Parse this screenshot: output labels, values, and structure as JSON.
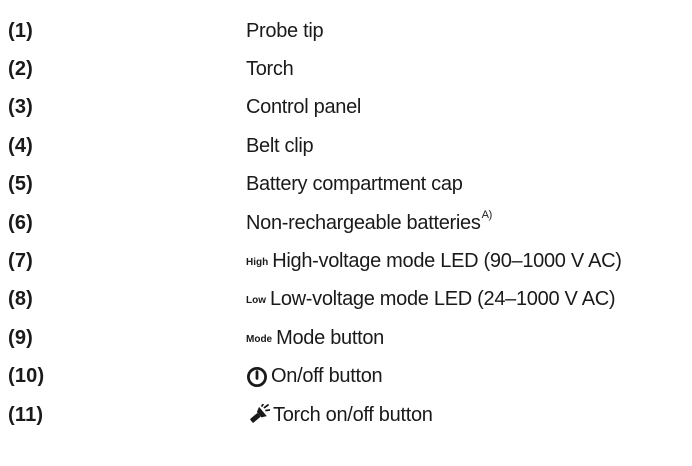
{
  "items": [
    {
      "num": "(1)",
      "text": "Probe tip"
    },
    {
      "num": "(2)",
      "text": "Torch"
    },
    {
      "num": "(3)",
      "text": "Control panel"
    },
    {
      "num": "(4)",
      "text": "Belt clip"
    },
    {
      "num": "(5)",
      "text": "Battery compartment cap"
    },
    {
      "num": "(6)",
      "text": "Non-rechargeable batteries",
      "sup": "A)"
    },
    {
      "num": "(7)",
      "tag": "High",
      "text": "High-voltage mode LED (90–1000 V AC)"
    },
    {
      "num": "(8)",
      "tag": "Low",
      "text": "Low-voltage mode LED (24–1000 V AC)"
    },
    {
      "num": "(9)",
      "tag": "Mode",
      "text": "Mode button"
    },
    {
      "num": "(10)",
      "icon": "power-icon",
      "text": "On/off button"
    },
    {
      "num": "(11)",
      "icon": "torch-icon",
      "text": "Torch on/off button"
    }
  ],
  "colors": {
    "text": "#1a1a1a",
    "background": "#ffffff"
  }
}
